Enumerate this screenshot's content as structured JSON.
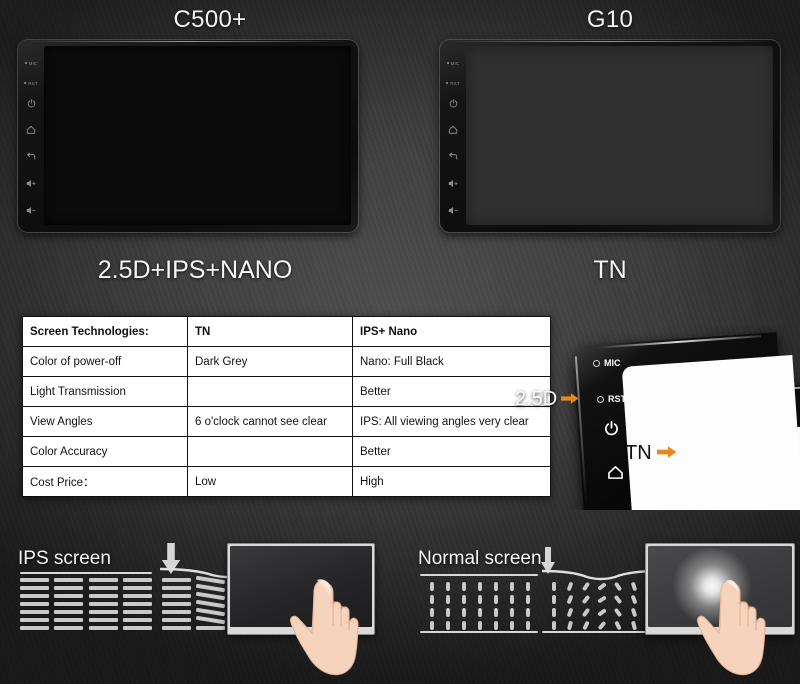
{
  "top": {
    "devices": [
      {
        "name": "C500+",
        "screen_tech": "2.5D+IPS+NANO",
        "screen_color": "#0b0b0b"
      },
      {
        "name": "G10",
        "screen_tech": "TN",
        "screen_color": "#2f2f2f"
      }
    ],
    "side_buttons": [
      "MIC",
      "RST",
      "power-icon",
      "home-icon",
      "back-icon",
      "volume-up-icon",
      "volume-down-icon"
    ]
  },
  "table": {
    "columns": [
      "Screen Technologies:",
      "TN",
      "IPS+ Nano"
    ],
    "rows": [
      {
        "label": "Color of power-off",
        "tn": "Dark Grey",
        "ips": "Nano: Full Black"
      },
      {
        "label": "Light Transmission",
        "tn": "",
        "ips": "Better"
      },
      {
        "label": "View Angles",
        "tn": "6 o'clock cannot see clear",
        "ips": "IPS: All viewing angles very clear"
      },
      {
        "label": "Color Accuracy",
        "tn": "",
        "ips": "Better"
      },
      {
        "label": "Cost Price：",
        "tn": "Low",
        "ips": "High"
      }
    ]
  },
  "bezel": {
    "front_label": "2.5D",
    "back_label": "TN",
    "arrow": "➡",
    "accent_color": "#e8871e",
    "front_pins": [
      "MIC",
      "RST"
    ],
    "back_pins": [
      "MIC",
      "RST"
    ],
    "front_icons": [
      "power-icon",
      "home-icon"
    ]
  },
  "bottom": {
    "ips": {
      "label": "IPS screen",
      "arrow": "down-arrow-icon",
      "crystal_orientation": "horizontal",
      "touch_result": "no-glow"
    },
    "normal": {
      "label": "Normal screen",
      "arrow": "down-arrow-icon",
      "crystal_orientation": "vertical",
      "touch_result": "white-glow-halo"
    }
  }
}
